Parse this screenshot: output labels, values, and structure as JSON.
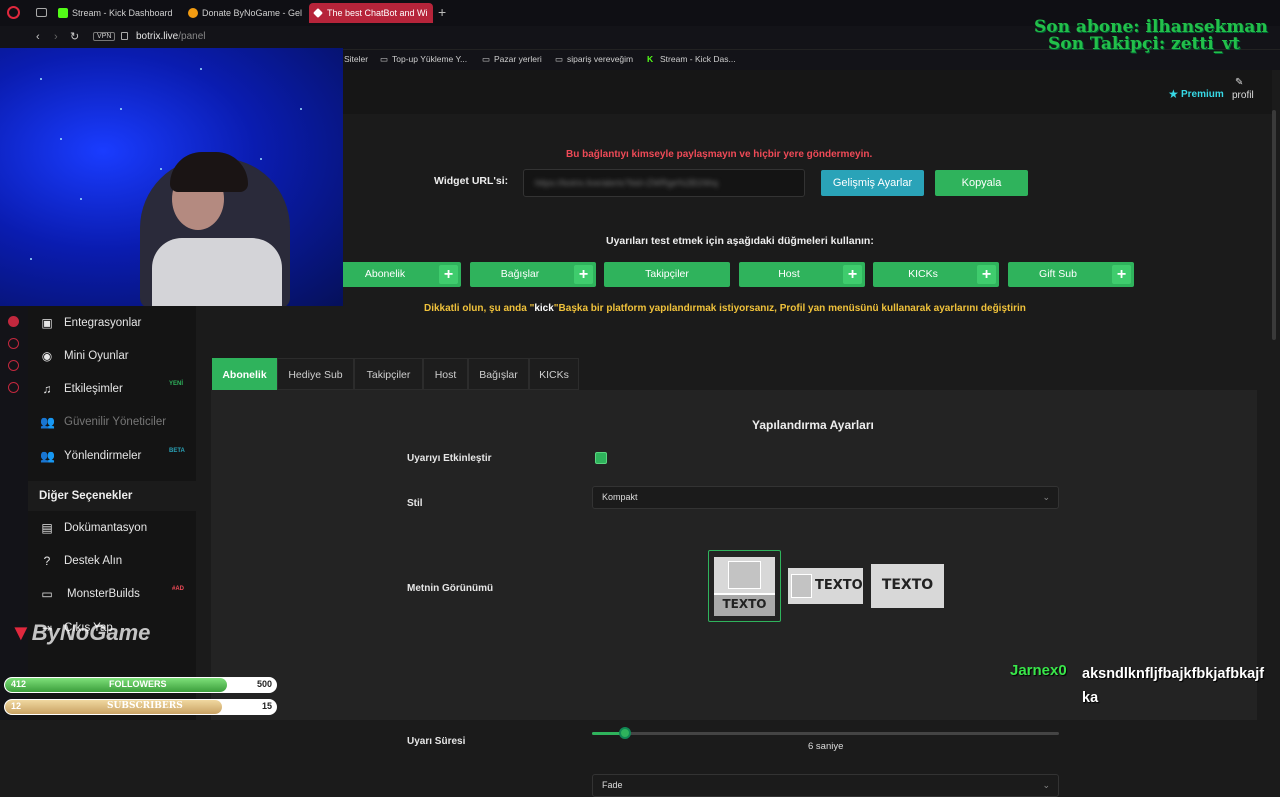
{
  "browser": {
    "tabs": [
      {
        "label": "Stream - Kick Dashboard",
        "icon": "kick-icon"
      },
      {
        "label": "Donate ByNoGame - Geli",
        "icon": "bynogame-icon"
      },
      {
        "label": "The best ChatBot and Wi",
        "icon": "botrix-icon",
        "active": true
      }
    ],
    "url_prefix": "botrix.live",
    "url_path": "/panel",
    "vpn_label": "VPN",
    "bookmarks": [
      "Siteler",
      "Top-up Yükleme Y...",
      "Pazar yerleri",
      "sipariş vereveğim",
      "Stream - Kick Das..."
    ]
  },
  "header": {
    "premium_label": "Premium",
    "profile_label": "profil"
  },
  "main": {
    "warning": "Bu bağlantıyı kimseyle paylaşmayın ve hiçbir yere göndermeyin.",
    "widget_url_label": "Widget URL'si:",
    "widget_url_value": "https://botrix.live/alerts?bid=ZWRge%2B1Nhq",
    "advanced_button": "Gelişmiş Ayarlar",
    "copy_button": "Kopyala",
    "test_instructions": "Uyarıları test etmek için aşağıdaki düğmeleri kullanın:",
    "test_buttons": [
      "Abonelik",
      "Bağışlar",
      "Takipçiler",
      "Host",
      "KICKs",
      "Gift Sub"
    ],
    "notice_prefix": "Dikkatli olun, şu anda \"",
    "notice_platform": "kick",
    "notice_suffix": "\"Başka bir platform yapılandırmak istiyorsanız, Profil yan menüsünü kullanarak ayarlarını değiştirin",
    "tabs": [
      "Abonelik",
      "Hediye Sub",
      "Takipçiler",
      "Host",
      "Bağışlar",
      "KICKs"
    ],
    "settings": {
      "title": "Yapılandırma Ayarları",
      "enable_label": "Uyarıyı Etkinleştir",
      "style_label": "Stil",
      "style_value": "Kompakt",
      "text_view_label": "Metnin Görünümü",
      "texto": "TEXTO",
      "duration_label": "Uyarı Süresi",
      "duration_value": "6 saniye",
      "duration_fraction": 0.04,
      "animation_value": "Fade"
    }
  },
  "sidebar": {
    "items": [
      {
        "label": "Entegrasyonlar",
        "icon": "integrations-icon"
      },
      {
        "label": "Mini Oyunlar",
        "icon": "gamepad-icon"
      },
      {
        "label": "Etkileşimler",
        "icon": "music-note-icon",
        "badge": "YENİ"
      },
      {
        "label": "Güvenilir Yöneticiler",
        "icon": "users-icon",
        "disabled": true
      },
      {
        "label": "Yönlendirmeler",
        "icon": "users-icon",
        "badge": "BETA"
      }
    ],
    "section_title": "Diğer Seçenekler",
    "other_items": [
      {
        "label": "Dokümantasyon",
        "icon": "document-icon"
      },
      {
        "label": "Destek Alın",
        "icon": "help-icon"
      },
      {
        "label": "MonsterBuilds",
        "icon": "laptop-icon",
        "badge": "#AD"
      },
      {
        "label": "Çıkış Yap",
        "icon": "logout-icon"
      }
    ]
  },
  "overlay": {
    "last_sub": "Son abone: ilhansekman",
    "last_follower": "Son Takipçi: zetti_vt",
    "logo": "ByNoGame",
    "followers": {
      "current": "412",
      "label": "FOLLOWERS",
      "goal": "500",
      "fraction": 0.82
    },
    "subscribers": {
      "current": "12",
      "label": "SUBSCRIBERS",
      "goal": "15",
      "fraction": 0.8
    },
    "chat_user": "Jarnex0",
    "chat_message": "aksndlknfljfbajkfbkjafbkajfka"
  },
  "colors": {
    "accent": "#2fb35c",
    "warning": "#ef4a57",
    "notice": "#f0c23b",
    "tab_active": "#b6243a"
  }
}
